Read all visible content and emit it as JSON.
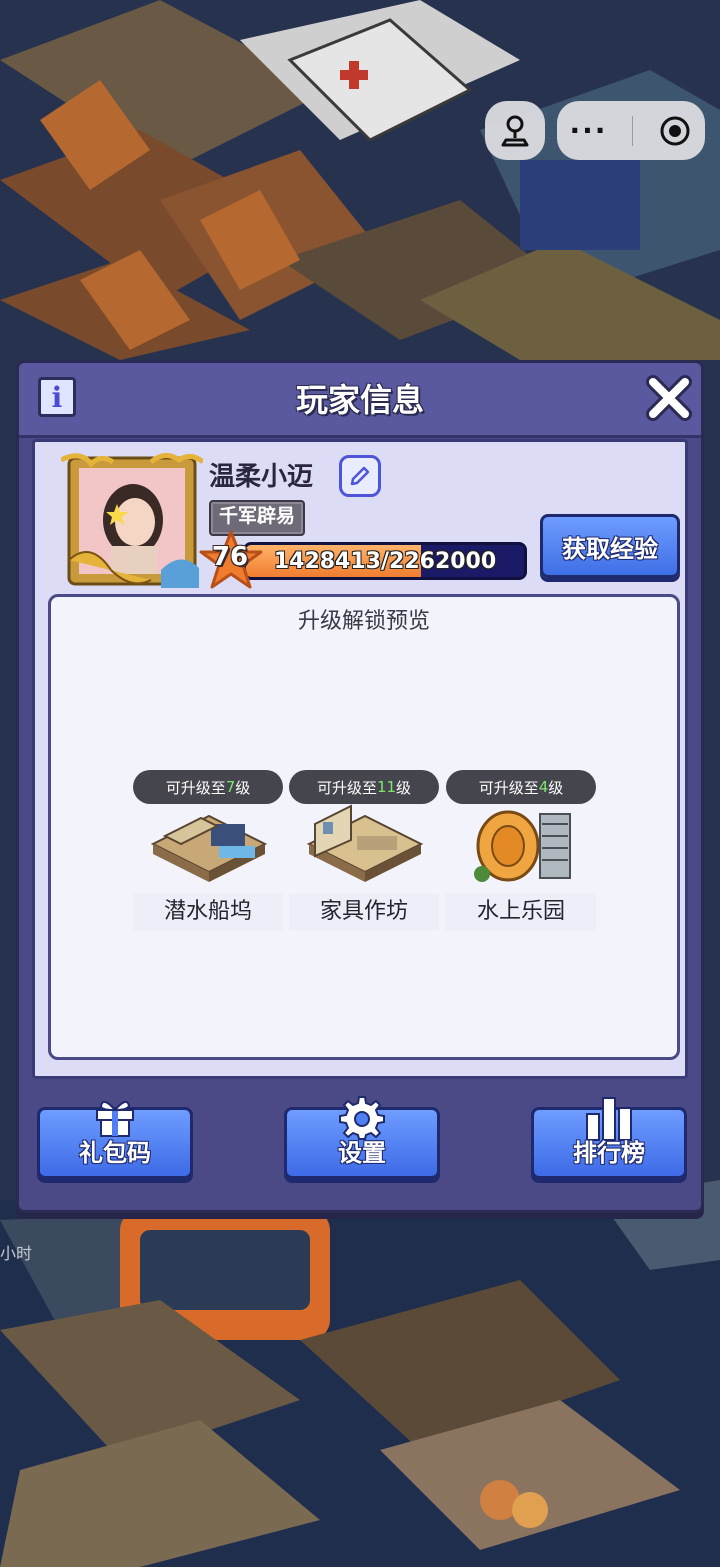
{
  "capsule": {
    "single_icon": "game-controller-icon",
    "more_icon": "more-dots-icon",
    "close_icon": "target-circle-icon"
  },
  "dialog": {
    "title": "玩家信息",
    "info_label": "i",
    "player": {
      "name": "温柔小迈",
      "title_badge": "千军辟易",
      "level": "76",
      "exp_text": "1428413/2262000",
      "exp_fraction": 0.63
    },
    "get_exp_label": "获取经验",
    "preview": {
      "title": "升级解锁预览",
      "buildings": [
        {
          "prefix": "可升级至",
          "level": "7",
          "suffix": "级",
          "name": "潜水船坞"
        },
        {
          "prefix": "可升级至",
          "level": "11",
          "suffix": "级",
          "name": "家具作坊"
        },
        {
          "prefix": "可升级至",
          "level": "4",
          "suffix": "级",
          "name": "水上乐园"
        }
      ]
    },
    "buttons": {
      "gift_code": "礼包码",
      "settings": "设置",
      "ranking": "排行榜"
    }
  },
  "background": {
    "side_text": "小时"
  },
  "colors": {
    "dialog_bg": "#4b4a86",
    "panel_bg": "#dcdcf6",
    "button_blue": "#4f7ff2",
    "level_green": "#7ee86d",
    "exp_orange": "#f07d2f"
  }
}
